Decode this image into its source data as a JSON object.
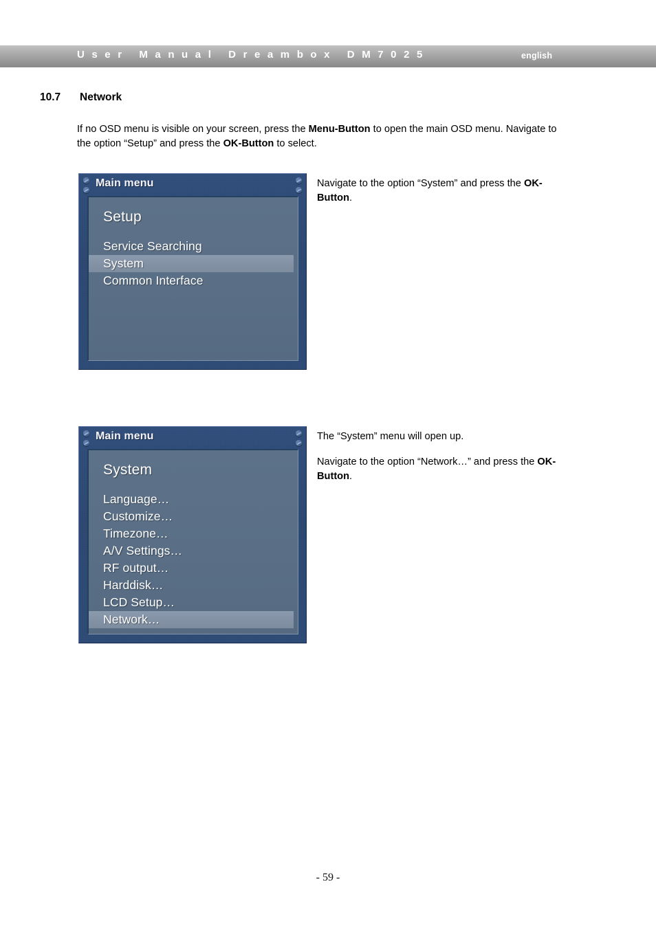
{
  "header": {
    "title": "U s e r   M a n u a l   D r e a m b o x   D M 7 0 2 5",
    "language": "english"
  },
  "section": {
    "number": "10.7",
    "title": "Network"
  },
  "body": {
    "intro_part1": "If no OSD menu is visible on your screen, press the ",
    "intro_bold1": "Menu-Button",
    "intro_part2": " to open the main OSD menu. Navigate to the option “Setup” and press the ",
    "intro_bold2": "OK-Button",
    "intro_part3": " to select."
  },
  "notes": {
    "note1_part1": "Navigate to the option “System” and press the ",
    "note1_bold": "OK-Button",
    "note1_part2": ".",
    "note2": "The “System” menu will open up.",
    "note3_part1": "Navigate to the option “Network…” and press the ",
    "note3_bold": "OK-Button",
    "note3_part2": "."
  },
  "osd1": {
    "window_title": "Main menu",
    "heading": "Setup",
    "items": [
      {
        "label": "Service Searching",
        "selected": false
      },
      {
        "label": "System",
        "selected": true
      },
      {
        "label": "Common Interface",
        "selected": false
      }
    ]
  },
  "osd2": {
    "window_title": "Main menu",
    "heading": "System",
    "items": [
      {
        "label": "Language…",
        "selected": false
      },
      {
        "label": "Customize…",
        "selected": false
      },
      {
        "label": "Timezone…",
        "selected": false
      },
      {
        "label": "A/V Settings…",
        "selected": false
      },
      {
        "label": "RF output…",
        "selected": false
      },
      {
        "label": "Harddisk…",
        "selected": false
      },
      {
        "label": "LCD Setup…",
        "selected": false
      },
      {
        "label": "Network…",
        "selected": true
      }
    ]
  },
  "footer": {
    "page_label": "- 59 -"
  },
  "colors": {
    "osd_frame": "#2b4a77",
    "osd_panel": "#5a6f86",
    "osd_selection": "#8492a6",
    "header_gradient_top": "#c2c2c2",
    "header_gradient_bottom": "#878787"
  }
}
